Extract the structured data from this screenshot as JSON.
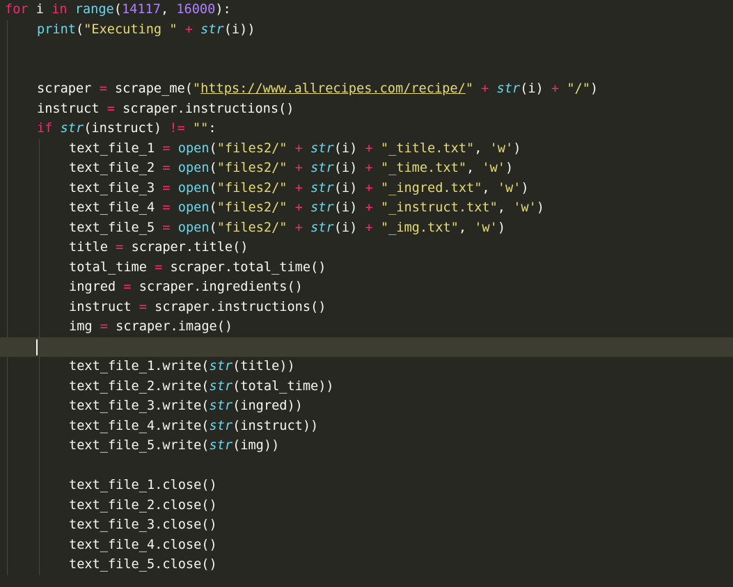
{
  "editor": {
    "theme_colors": {
      "background": "#272822",
      "active_line": "#3e3d32",
      "foreground": "#f8f8f2",
      "keyword": "#f92672",
      "function": "#66d9ef",
      "number": "#ae81ff",
      "string": "#e6db74",
      "indent_guide": "#464741"
    },
    "lines": [
      {
        "indent": 0,
        "tokens": [
          {
            "t": "kw",
            "v": "for"
          },
          {
            "t": "plain",
            "v": " i "
          },
          {
            "t": "kw",
            "v": "in"
          },
          {
            "t": "plain",
            "v": " "
          },
          {
            "t": "fn",
            "v": "range"
          },
          {
            "t": "plain",
            "v": "("
          },
          {
            "t": "num",
            "v": "14117"
          },
          {
            "t": "plain",
            "v": ", "
          },
          {
            "t": "num",
            "v": "16000"
          },
          {
            "t": "plain",
            "v": "):"
          }
        ]
      },
      {
        "indent": 1,
        "tokens": [
          {
            "t": "fn",
            "v": "print"
          },
          {
            "t": "plain",
            "v": "("
          },
          {
            "t": "str",
            "v": "\"Executing \""
          },
          {
            "t": "plain",
            "v": " "
          },
          {
            "t": "op",
            "v": "+"
          },
          {
            "t": "plain",
            "v": " "
          },
          {
            "t": "type",
            "v": "str"
          },
          {
            "t": "plain",
            "v": "(i))"
          }
        ]
      },
      {
        "indent": 1,
        "tokens": []
      },
      {
        "indent": 1,
        "tokens": []
      },
      {
        "indent": 1,
        "tokens": [
          {
            "t": "plain",
            "v": "scraper "
          },
          {
            "t": "op",
            "v": "="
          },
          {
            "t": "plain",
            "v": " scrape_me("
          },
          {
            "t": "str",
            "v": "\""
          },
          {
            "t": "url",
            "v": "https://www.allrecipes.com/recipe/"
          },
          {
            "t": "str",
            "v": "\""
          },
          {
            "t": "plain",
            "v": " "
          },
          {
            "t": "op",
            "v": "+"
          },
          {
            "t": "plain",
            "v": " "
          },
          {
            "t": "type",
            "v": "str"
          },
          {
            "t": "plain",
            "v": "(i) "
          },
          {
            "t": "op",
            "v": "+"
          },
          {
            "t": "plain",
            "v": " "
          },
          {
            "t": "str",
            "v": "\"/\""
          },
          {
            "t": "plain",
            "v": ")"
          }
        ]
      },
      {
        "indent": 1,
        "tokens": [
          {
            "t": "plain",
            "v": "instruct "
          },
          {
            "t": "op",
            "v": "="
          },
          {
            "t": "plain",
            "v": " scraper.instructions()"
          }
        ]
      },
      {
        "indent": 1,
        "tokens": [
          {
            "t": "kw",
            "v": "if"
          },
          {
            "t": "plain",
            "v": " "
          },
          {
            "t": "type",
            "v": "str"
          },
          {
            "t": "plain",
            "v": "(instruct) "
          },
          {
            "t": "op",
            "v": "!="
          },
          {
            "t": "plain",
            "v": " "
          },
          {
            "t": "str",
            "v": "\"\""
          },
          {
            "t": "plain",
            "v": ":"
          }
        ]
      },
      {
        "indent": 2,
        "tokens": [
          {
            "t": "plain",
            "v": "text_file_1 "
          },
          {
            "t": "op",
            "v": "="
          },
          {
            "t": "plain",
            "v": " "
          },
          {
            "t": "fn",
            "v": "open"
          },
          {
            "t": "plain",
            "v": "("
          },
          {
            "t": "str",
            "v": "\"files2/\""
          },
          {
            "t": "plain",
            "v": " "
          },
          {
            "t": "op",
            "v": "+"
          },
          {
            "t": "plain",
            "v": " "
          },
          {
            "t": "type",
            "v": "str"
          },
          {
            "t": "plain",
            "v": "(i) "
          },
          {
            "t": "op",
            "v": "+"
          },
          {
            "t": "plain",
            "v": " "
          },
          {
            "t": "str",
            "v": "\"_title.txt\""
          },
          {
            "t": "plain",
            "v": ", "
          },
          {
            "t": "str",
            "v": "'w'"
          },
          {
            "t": "plain",
            "v": ")"
          }
        ]
      },
      {
        "indent": 2,
        "tokens": [
          {
            "t": "plain",
            "v": "text_file_2 "
          },
          {
            "t": "op",
            "v": "="
          },
          {
            "t": "plain",
            "v": " "
          },
          {
            "t": "fn",
            "v": "open"
          },
          {
            "t": "plain",
            "v": "("
          },
          {
            "t": "str",
            "v": "\"files2/\""
          },
          {
            "t": "plain",
            "v": " "
          },
          {
            "t": "op",
            "v": "+"
          },
          {
            "t": "plain",
            "v": " "
          },
          {
            "t": "type",
            "v": "str"
          },
          {
            "t": "plain",
            "v": "(i) "
          },
          {
            "t": "op",
            "v": "+"
          },
          {
            "t": "plain",
            "v": " "
          },
          {
            "t": "str",
            "v": "\"_time.txt\""
          },
          {
            "t": "plain",
            "v": ", "
          },
          {
            "t": "str",
            "v": "'w'"
          },
          {
            "t": "plain",
            "v": ")"
          }
        ]
      },
      {
        "indent": 2,
        "tokens": [
          {
            "t": "plain",
            "v": "text_file_3 "
          },
          {
            "t": "op",
            "v": "="
          },
          {
            "t": "plain",
            "v": " "
          },
          {
            "t": "fn",
            "v": "open"
          },
          {
            "t": "plain",
            "v": "("
          },
          {
            "t": "str",
            "v": "\"files2/\""
          },
          {
            "t": "plain",
            "v": " "
          },
          {
            "t": "op",
            "v": "+"
          },
          {
            "t": "plain",
            "v": " "
          },
          {
            "t": "type",
            "v": "str"
          },
          {
            "t": "plain",
            "v": "(i) "
          },
          {
            "t": "op",
            "v": "+"
          },
          {
            "t": "plain",
            "v": " "
          },
          {
            "t": "str",
            "v": "\"_ingred.txt\""
          },
          {
            "t": "plain",
            "v": ", "
          },
          {
            "t": "str",
            "v": "'w'"
          },
          {
            "t": "plain",
            "v": ")"
          }
        ]
      },
      {
        "indent": 2,
        "tokens": [
          {
            "t": "plain",
            "v": "text_file_4 "
          },
          {
            "t": "op",
            "v": "="
          },
          {
            "t": "plain",
            "v": " "
          },
          {
            "t": "fn",
            "v": "open"
          },
          {
            "t": "plain",
            "v": "("
          },
          {
            "t": "str",
            "v": "\"files2/\""
          },
          {
            "t": "plain",
            "v": " "
          },
          {
            "t": "op",
            "v": "+"
          },
          {
            "t": "plain",
            "v": " "
          },
          {
            "t": "type",
            "v": "str"
          },
          {
            "t": "plain",
            "v": "(i) "
          },
          {
            "t": "op",
            "v": "+"
          },
          {
            "t": "plain",
            "v": " "
          },
          {
            "t": "str",
            "v": "\"_instruct.txt\""
          },
          {
            "t": "plain",
            "v": ", "
          },
          {
            "t": "str",
            "v": "'w'"
          },
          {
            "t": "plain",
            "v": ")"
          }
        ]
      },
      {
        "indent": 2,
        "tokens": [
          {
            "t": "plain",
            "v": "text_file_5 "
          },
          {
            "t": "op",
            "v": "="
          },
          {
            "t": "plain",
            "v": " "
          },
          {
            "t": "fn",
            "v": "open"
          },
          {
            "t": "plain",
            "v": "("
          },
          {
            "t": "str",
            "v": "\"files2/\""
          },
          {
            "t": "plain",
            "v": " "
          },
          {
            "t": "op",
            "v": "+"
          },
          {
            "t": "plain",
            "v": " "
          },
          {
            "t": "type",
            "v": "str"
          },
          {
            "t": "plain",
            "v": "(i) "
          },
          {
            "t": "op",
            "v": "+"
          },
          {
            "t": "plain",
            "v": " "
          },
          {
            "t": "str",
            "v": "\"_img.txt\""
          },
          {
            "t": "plain",
            "v": ", "
          },
          {
            "t": "str",
            "v": "'w'"
          },
          {
            "t": "plain",
            "v": ")"
          }
        ]
      },
      {
        "indent": 2,
        "tokens": [
          {
            "t": "plain",
            "v": "title "
          },
          {
            "t": "op",
            "v": "="
          },
          {
            "t": "plain",
            "v": " scraper.title()"
          }
        ]
      },
      {
        "indent": 2,
        "tokens": [
          {
            "t": "plain",
            "v": "total_time "
          },
          {
            "t": "op",
            "v": "="
          },
          {
            "t": "plain",
            "v": " scraper.total_time()"
          }
        ]
      },
      {
        "indent": 2,
        "tokens": [
          {
            "t": "plain",
            "v": "ingred "
          },
          {
            "t": "op",
            "v": "="
          },
          {
            "t": "plain",
            "v": " scraper.ingredients()"
          }
        ]
      },
      {
        "indent": 2,
        "tokens": [
          {
            "t": "plain",
            "v": "instruct "
          },
          {
            "t": "op",
            "v": "="
          },
          {
            "t": "plain",
            "v": " scraper.instructions()"
          }
        ]
      },
      {
        "indent": 2,
        "tokens": [
          {
            "t": "plain",
            "v": "img "
          },
          {
            "t": "op",
            "v": "="
          },
          {
            "t": "plain",
            "v": " scraper.image()"
          }
        ]
      },
      {
        "indent": 0,
        "active": true,
        "caret": true,
        "tokens": []
      },
      {
        "indent": 2,
        "tokens": [
          {
            "t": "plain",
            "v": "text_file_1.write("
          },
          {
            "t": "type",
            "v": "str"
          },
          {
            "t": "plain",
            "v": "(title))"
          }
        ]
      },
      {
        "indent": 2,
        "tokens": [
          {
            "t": "plain",
            "v": "text_file_2.write("
          },
          {
            "t": "type",
            "v": "str"
          },
          {
            "t": "plain",
            "v": "(total_time))"
          }
        ]
      },
      {
        "indent": 2,
        "tokens": [
          {
            "t": "plain",
            "v": "text_file_3.write("
          },
          {
            "t": "type",
            "v": "str"
          },
          {
            "t": "plain",
            "v": "(ingred))"
          }
        ]
      },
      {
        "indent": 2,
        "tokens": [
          {
            "t": "plain",
            "v": "text_file_4.write("
          },
          {
            "t": "type",
            "v": "str"
          },
          {
            "t": "plain",
            "v": "(instruct))"
          }
        ]
      },
      {
        "indent": 2,
        "tokens": [
          {
            "t": "plain",
            "v": "text_file_5.write("
          },
          {
            "t": "type",
            "v": "str"
          },
          {
            "t": "plain",
            "v": "(img))"
          }
        ]
      },
      {
        "indent": 2,
        "tokens": []
      },
      {
        "indent": 2,
        "tokens": [
          {
            "t": "plain",
            "v": "text_file_1.close()"
          }
        ]
      },
      {
        "indent": 2,
        "tokens": [
          {
            "t": "plain",
            "v": "text_file_2.close()"
          }
        ]
      },
      {
        "indent": 2,
        "tokens": [
          {
            "t": "plain",
            "v": "text_file_3.close()"
          }
        ]
      },
      {
        "indent": 2,
        "tokens": [
          {
            "t": "plain",
            "v": "text_file_4.close()"
          }
        ]
      },
      {
        "indent": 2,
        "tokens": [
          {
            "t": "plain",
            "v": "text_file_5.close()"
          }
        ]
      }
    ]
  }
}
